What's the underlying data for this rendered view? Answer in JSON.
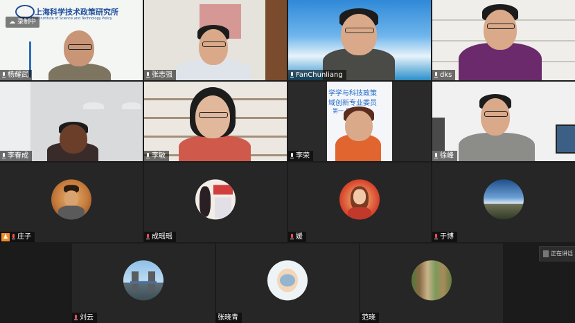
{
  "header": {
    "logo_cn": "上海科学技术政策研究所",
    "logo_en": "Shanghai Institute of Science and Technology Policy",
    "recording": "录制中"
  },
  "participants": [
    {
      "name": "杨耀武"
    },
    {
      "name": "张志强"
    },
    {
      "name": "FanChunliang"
    },
    {
      "name": "dks"
    },
    {
      "name": "李春成"
    },
    {
      "name": "李敏"
    },
    {
      "name": "李荣"
    },
    {
      "name": "徐峰"
    },
    {
      "name": "庄子"
    },
    {
      "name": "成瑶瑶"
    },
    {
      "name": "媛"
    },
    {
      "name": "于博"
    },
    {
      "name": "刘云"
    },
    {
      "name": "张晓青"
    },
    {
      "name": "范晓"
    }
  ],
  "slide": {
    "line1": "学学与科技政策",
    "line2": "域创新专业委员",
    "line3": "第一  员会会议"
  },
  "speaking_panel": {
    "label": "正在讲话"
  },
  "colors": {
    "tile_bg": "#262626",
    "screen_bg": "#1b1b1b",
    "muted": "#ff4d4f",
    "host_badge": "#f08c2a"
  }
}
